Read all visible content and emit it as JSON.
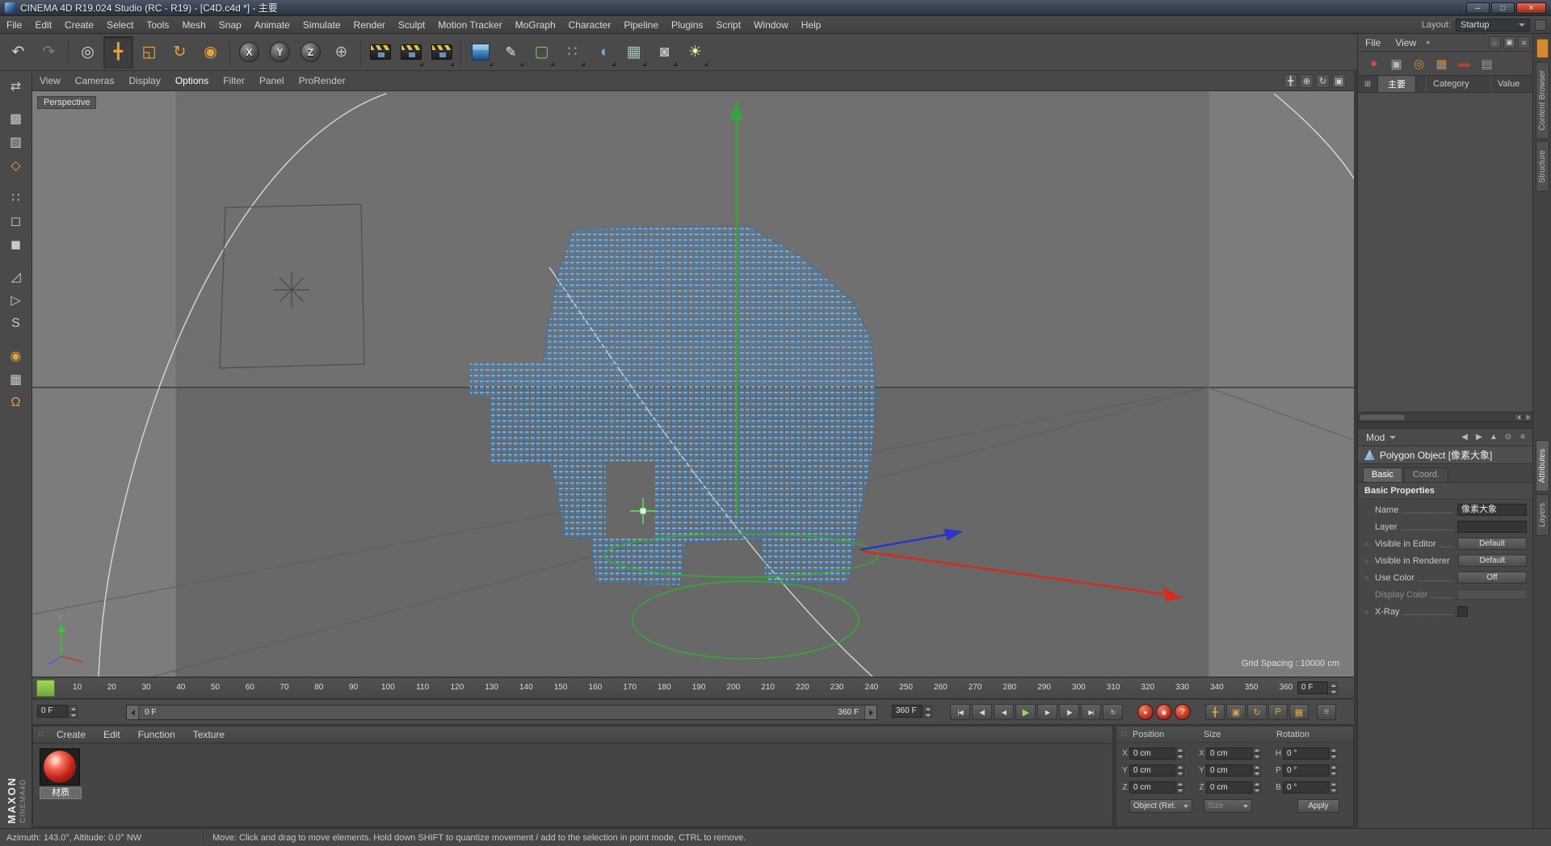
{
  "window": {
    "title": "CINEMA 4D R19.024 Studio (RC - R19) - [C4D.c4d *] - 主要",
    "layout_label": "Layout:",
    "layout_value": "Startup"
  },
  "menubar": {
    "items": [
      "File",
      "Edit",
      "Create",
      "Select",
      "Tools",
      "Mesh",
      "Snap",
      "Animate",
      "Simulate",
      "Render",
      "Sculpt",
      "Motion Tracker",
      "MoGraph",
      "Character",
      "Pipeline",
      "Plugins",
      "Script",
      "Window",
      "Help"
    ]
  },
  "toolbar": {
    "items": [
      {
        "name": "undo-button",
        "glyph": "↶"
      },
      {
        "name": "redo-button",
        "glyph": "↷",
        "cls": "disabled"
      },
      {
        "sep": true
      },
      {
        "name": "live-selection-tool",
        "glyph": "◎"
      },
      {
        "name": "move-tool",
        "glyph": "╋",
        "cls": "orange active"
      },
      {
        "name": "scale-tool",
        "glyph": "◱",
        "cls": "orange"
      },
      {
        "name": "rotate-tool",
        "glyph": "↻",
        "cls": "orange"
      },
      {
        "name": "last-used-tool",
        "glyph": "◉",
        "cls": "orange"
      },
      {
        "sep": true
      },
      {
        "name": "lock-x-axis-button",
        "glyph": "X",
        "cls": "axis"
      },
      {
        "name": "lock-y-axis-button",
        "glyph": "Y",
        "cls": "axis"
      },
      {
        "name": "lock-z-axis-button",
        "glyph": "Z",
        "cls": "axis"
      },
      {
        "name": "coordinate-system-button",
        "glyph": "⊕",
        "cls": "gray"
      },
      {
        "sep": true
      },
      {
        "name": "render-view-button",
        "cls": "clapper"
      },
      {
        "name": "render-picture-viewer-button",
        "cls": "clapper",
        "fly": true
      },
      {
        "name": "render-settings-button",
        "cls": "clapper gear",
        "fly": true
      },
      {
        "sep": true
      },
      {
        "name": "primitive-cube-button",
        "cls": "cube3d",
        "fly": true
      },
      {
        "name": "pen-spline-tool",
        "glyph": "✎",
        "cls": "pen",
        "fly": true
      },
      {
        "name": "subdivision-surface-button",
        "glyph": "▢",
        "cls": "green",
        "fly": true
      },
      {
        "name": "cloner-button",
        "glyph": "∷",
        "cls": "green",
        "fly": true
      },
      {
        "name": "deformer-button",
        "glyph": "◖",
        "cls": "blue",
        "fly": true
      },
      {
        "name": "environment-button",
        "glyph": "▦",
        "cls": "teal",
        "fly": true
      },
      {
        "name": "camera-button",
        "glyph": "◙",
        "cls": "gray",
        "fly": true
      },
      {
        "name": "light-button",
        "glyph": "☀",
        "cls": "light",
        "fly": true
      }
    ]
  },
  "left_toolbar": {
    "items": [
      {
        "name": "make-editable-button",
        "glyph": "⇄"
      },
      {
        "gap": true
      },
      {
        "name": "model-mode-button",
        "glyph": "▩"
      },
      {
        "name": "texture-mode-button",
        "glyph": "▨"
      },
      {
        "name": "workplane-mode-button",
        "glyph": "◇",
        "cls": "orange"
      },
      {
        "gap": true
      },
      {
        "name": "points-mode-button",
        "glyph": "∷"
      },
      {
        "name": "edges-mode-button",
        "glyph": "◻"
      },
      {
        "name": "polygons-mode-button",
        "glyph": "◼"
      },
      {
        "gap": true
      },
      {
        "name": "measure-tool-button",
        "glyph": "◿"
      },
      {
        "name": "tweak-mode-button",
        "glyph": "▷"
      },
      {
        "name": "snap-toggle-button",
        "glyph": "S"
      },
      {
        "gap": true
      },
      {
        "name": "solo-mode-button",
        "glyph": "◉",
        "cls": "orange"
      },
      {
        "name": "lock-workplane-button",
        "glyph": "▦"
      },
      {
        "name": "snap-settings-button",
        "glyph": "Ω",
        "cls": "orange"
      }
    ]
  },
  "viewport": {
    "menu": [
      "View",
      "Cameras",
      "Display",
      "Options",
      "Filter",
      "Panel",
      "ProRender"
    ],
    "active_menu": "Options",
    "nav_icons": [
      {
        "name": "pan-view-button",
        "glyph": "╋"
      },
      {
        "name": "zoom-view-button",
        "glyph": "⊕"
      },
      {
        "name": "rotate-view-button",
        "glyph": "↻"
      },
      {
        "name": "toggle-view-button",
        "glyph": "▣"
      }
    ],
    "camera_label": "Perspective",
    "grid_spacing": "Grid Spacing : 10000 cm",
    "axis_y": "Y"
  },
  "timeline": {
    "ticks": [
      10,
      20,
      30,
      40,
      50,
      60,
      70,
      80,
      90,
      100,
      110,
      120,
      130,
      140,
      150,
      160,
      170,
      180,
      190,
      200,
      210,
      220,
      230,
      240,
      250,
      260,
      270,
      280,
      290,
      300,
      310,
      320,
      330,
      340,
      350,
      360
    ],
    "ruler_frame": "0 F",
    "current_frame": "0 F",
    "range_start": "0 F",
    "range_end": "360 F",
    "end_frame": "360 F",
    "transport": [
      {
        "name": "goto-start-button",
        "glyph": "|◀"
      },
      {
        "name": "prev-key-button",
        "glyph": "◀|"
      },
      {
        "name": "prev-frame-button",
        "glyph": "◀"
      },
      {
        "name": "play-button",
        "glyph": "▶",
        "accent": true
      },
      {
        "name": "next-frame-button",
        "glyph": "▶"
      },
      {
        "name": "next-key-button",
        "glyph": "|▶"
      },
      {
        "name": "goto-end-button",
        "glyph": "▶|"
      },
      {
        "name": "loop-button",
        "glyph": "↻"
      }
    ],
    "record_buttons": [
      {
        "name": "record-keyframe-button",
        "glyph": "●"
      },
      {
        "name": "autokey-button",
        "glyph": "◉"
      },
      {
        "name": "record-options-button",
        "glyph": "?"
      }
    ],
    "record_toggles": [
      {
        "name": "record-position-toggle",
        "glyph": "╋"
      },
      {
        "name": "record-scale-toggle",
        "glyph": "▣"
      },
      {
        "name": "record-rotation-toggle",
        "glyph": "↻"
      },
      {
        "name": "record-parameter-toggle",
        "glyph": "P"
      },
      {
        "name": "keyframe-selection-button",
        "glyph": "▦"
      },
      {
        "name": "timeline-layout-button",
        "glyph": "≡",
        "cls": "blue"
      }
    ]
  },
  "materials": {
    "menus": [
      "Create",
      "Edit",
      "Function",
      "Texture"
    ],
    "items": [
      {
        "label": "材质"
      }
    ]
  },
  "coordinates": {
    "headers": [
      "Position",
      "Size",
      "Rotation"
    ],
    "rows": [
      {
        "pos_label": "X",
        "pos_value": "0 cm",
        "size_label": "X",
        "size_value": "0 cm",
        "rot_label": "H",
        "rot_value": "0 °"
      },
      {
        "pos_label": "Y",
        "pos_value": "0 cm",
        "size_label": "Y",
        "size_value": "0 cm",
        "rot_label": "P",
        "rot_value": "0 °"
      },
      {
        "pos_label": "Z",
        "pos_value": "0 cm",
        "size_label": "Z",
        "size_value": "0 cm",
        "rot_label": "B",
        "rot_value": "0 °"
      }
    ],
    "object_mode": "Object (Rel.",
    "size_mode": "Size",
    "apply_label": "Apply"
  },
  "object_manager": {
    "menus": [
      "File",
      "View"
    ],
    "corner_icons": [
      {
        "name": "search-icon",
        "glyph": "○"
      },
      {
        "name": "pin-icon",
        "glyph": "▣"
      },
      {
        "name": "panel-menu-icon",
        "glyph": "≡"
      }
    ],
    "icons": [
      {
        "name": "materials-page-icon",
        "glyph": "●",
        "color": "#d34a3a"
      },
      {
        "name": "objects-page-icon",
        "glyph": "▣",
        "color": "#b8b8b8"
      },
      {
        "name": "mograph-icon",
        "glyph": "◎",
        "color": "#e08a2e"
      },
      {
        "name": "plane-icon",
        "glyph": "▦",
        "color": "#e08a2e"
      },
      {
        "name": "render-clapper-icon",
        "glyph": "▬",
        "color": "#b04038"
      },
      {
        "name": "structure-icon",
        "glyph": "▤",
        "color": "#9f9f9f"
      }
    ],
    "tab": "主要",
    "columns": [
      "Category",
      "Value"
    ]
  },
  "attributes": {
    "mode_label": "Mod",
    "toolbar_icons": [
      {
        "name": "nav-back-icon",
        "glyph": "◀"
      },
      {
        "name": "nav-forward-icon",
        "glyph": "▶"
      },
      {
        "name": "pick-icon",
        "glyph": "▲"
      },
      {
        "name": "search-icon",
        "glyph": "⊙"
      },
      {
        "name": "panel-menu-icon",
        "glyph": "≡"
      }
    ],
    "object_title": "Polygon Object [像素大象]",
    "tabs": [
      {
        "label": "Basic",
        "active": true
      },
      {
        "label": "Coord.",
        "active": false
      }
    ],
    "section_title": "Basic Properties",
    "rows": [
      {
        "label": "Name",
        "type": "input",
        "value": "像素大象",
        "dot": false
      },
      {
        "label": "Layer",
        "type": "input",
        "value": "",
        "dot": false
      },
      {
        "label": "Visible in Editor",
        "type": "dropdown",
        "value": "Default",
        "dot": true
      },
      {
        "label": "Visible in Renderer",
        "type": "dropdown",
        "value": "Default",
        "dot": true
      },
      {
        "label": "Use Color",
        "type": "dropdown",
        "value": "Off",
        "dot": true
      },
      {
        "label": "Display Color",
        "type": "color",
        "value": "",
        "dot": false,
        "gray": true
      },
      {
        "label": "X-Ray",
        "type": "checkbox",
        "value": "",
        "dot": true
      }
    ]
  },
  "side_tabs": {
    "top": [
      {
        "label": "Content Browser",
        "active": false
      },
      {
        "label": "Structure",
        "active": false
      }
    ],
    "bottom": [
      {
        "label": "Attributes",
        "active": true
      },
      {
        "label": "Layers",
        "active": false
      }
    ]
  },
  "branding": {
    "line1": "MAXON",
    "line2": "CINEMA4D"
  },
  "status_bar": {
    "left": "Azimuth: 143.0°, Altitude: 0.0°  NW",
    "message": "Move: Click and drag to move elements. Hold down SHIFT to quantize movement / add to the selection in point mode, CTRL to remove."
  }
}
